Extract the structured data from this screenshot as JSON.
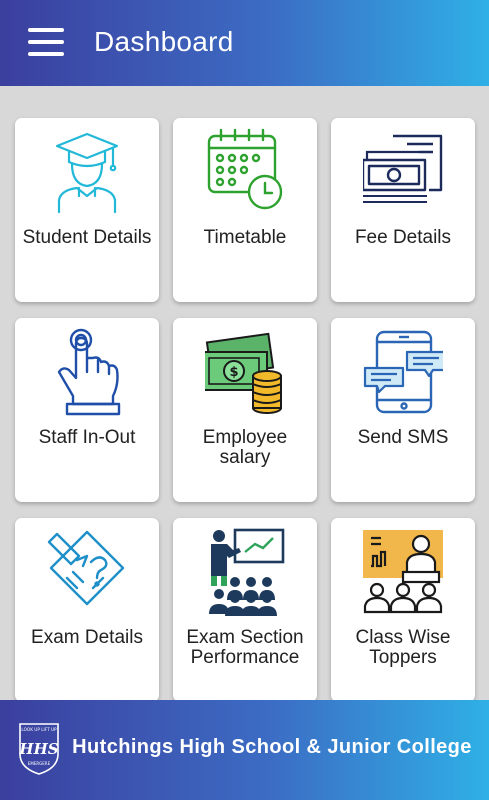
{
  "header": {
    "title": "Dashboard",
    "menu_icon": "hamburger-menu-icon"
  },
  "tiles": [
    {
      "label": "Student Details",
      "icon": "student-graduate-icon"
    },
    {
      "label": "Timetable",
      "icon": "calendar-clock-icon"
    },
    {
      "label": "Fee Details",
      "icon": "banknote-invoice-icon"
    },
    {
      "label": "Staff In-Out",
      "icon": "touch-finger-icon"
    },
    {
      "label": "Employee salary",
      "icon": "money-coins-icon"
    },
    {
      "label": "Send SMS",
      "icon": "phone-chat-icon"
    },
    {
      "label": "Exam Details",
      "icon": "exam-paper-pencil-icon"
    },
    {
      "label": "Exam Section Performance",
      "icon": "presentation-class-icon"
    },
    {
      "label": "Class Wise Toppers",
      "icon": "speaker-audience-icon"
    }
  ],
  "footer": {
    "school_name": "Hutchings High School & Junior College",
    "logo_text": "HHS",
    "logo_motto_top": "LOOK UP LIFT UP",
    "logo_motto_bottom": "EMERGERE"
  },
  "colors": {
    "header_start": "#3b3f9e",
    "header_end": "#2fb0e6",
    "background": "#d8d8d8",
    "card": "#ffffff"
  }
}
